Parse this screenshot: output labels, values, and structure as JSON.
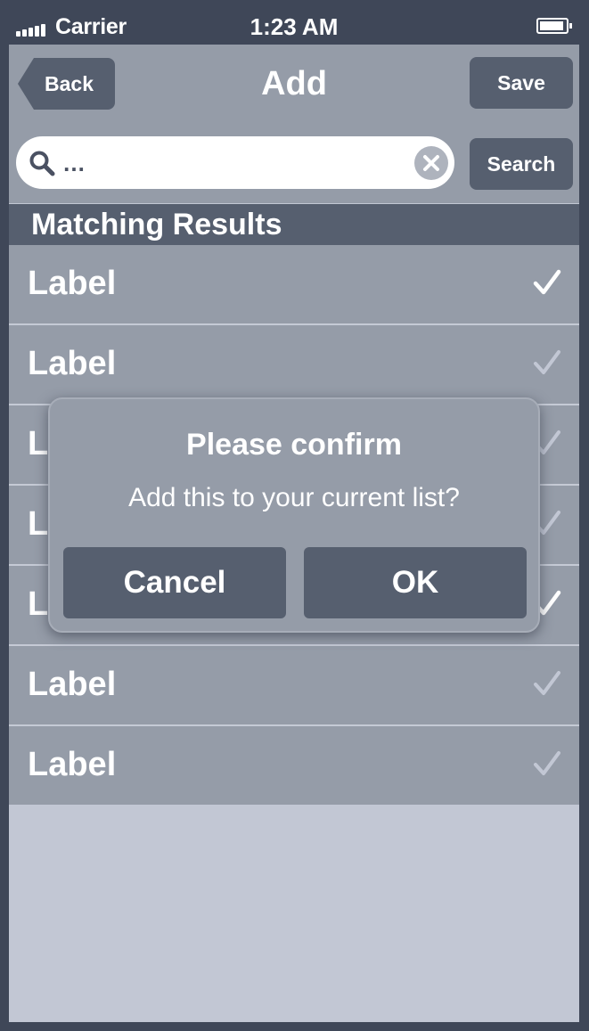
{
  "status_bar": {
    "carrier": "Carrier",
    "time": "1:23 AM"
  },
  "nav": {
    "back_label": "Back",
    "title": "Add",
    "save_label": "Save"
  },
  "search": {
    "value": "…",
    "button_label": "Search"
  },
  "section": {
    "title": "Matching Results"
  },
  "list": {
    "items": [
      {
        "label": "Label",
        "checked": true
      },
      {
        "label": "Label",
        "checked": false
      },
      {
        "label": "Label",
        "checked": false
      },
      {
        "label": "Label",
        "checked": false
      },
      {
        "label": "Label",
        "checked": true
      },
      {
        "label": "Label",
        "checked": false
      },
      {
        "label": "Label",
        "checked": false
      }
    ]
  },
  "dialog": {
    "title": "Please confirm",
    "message": "Add this to your current list?",
    "cancel_label": "Cancel",
    "ok_label": "OK"
  },
  "colors": {
    "frame": "#3f4758",
    "bar": "#959ca8",
    "button": "#565f6f",
    "background": "#c2c7d4",
    "check_active": "#ffffff",
    "check_inactive": "#c2c7d4"
  }
}
